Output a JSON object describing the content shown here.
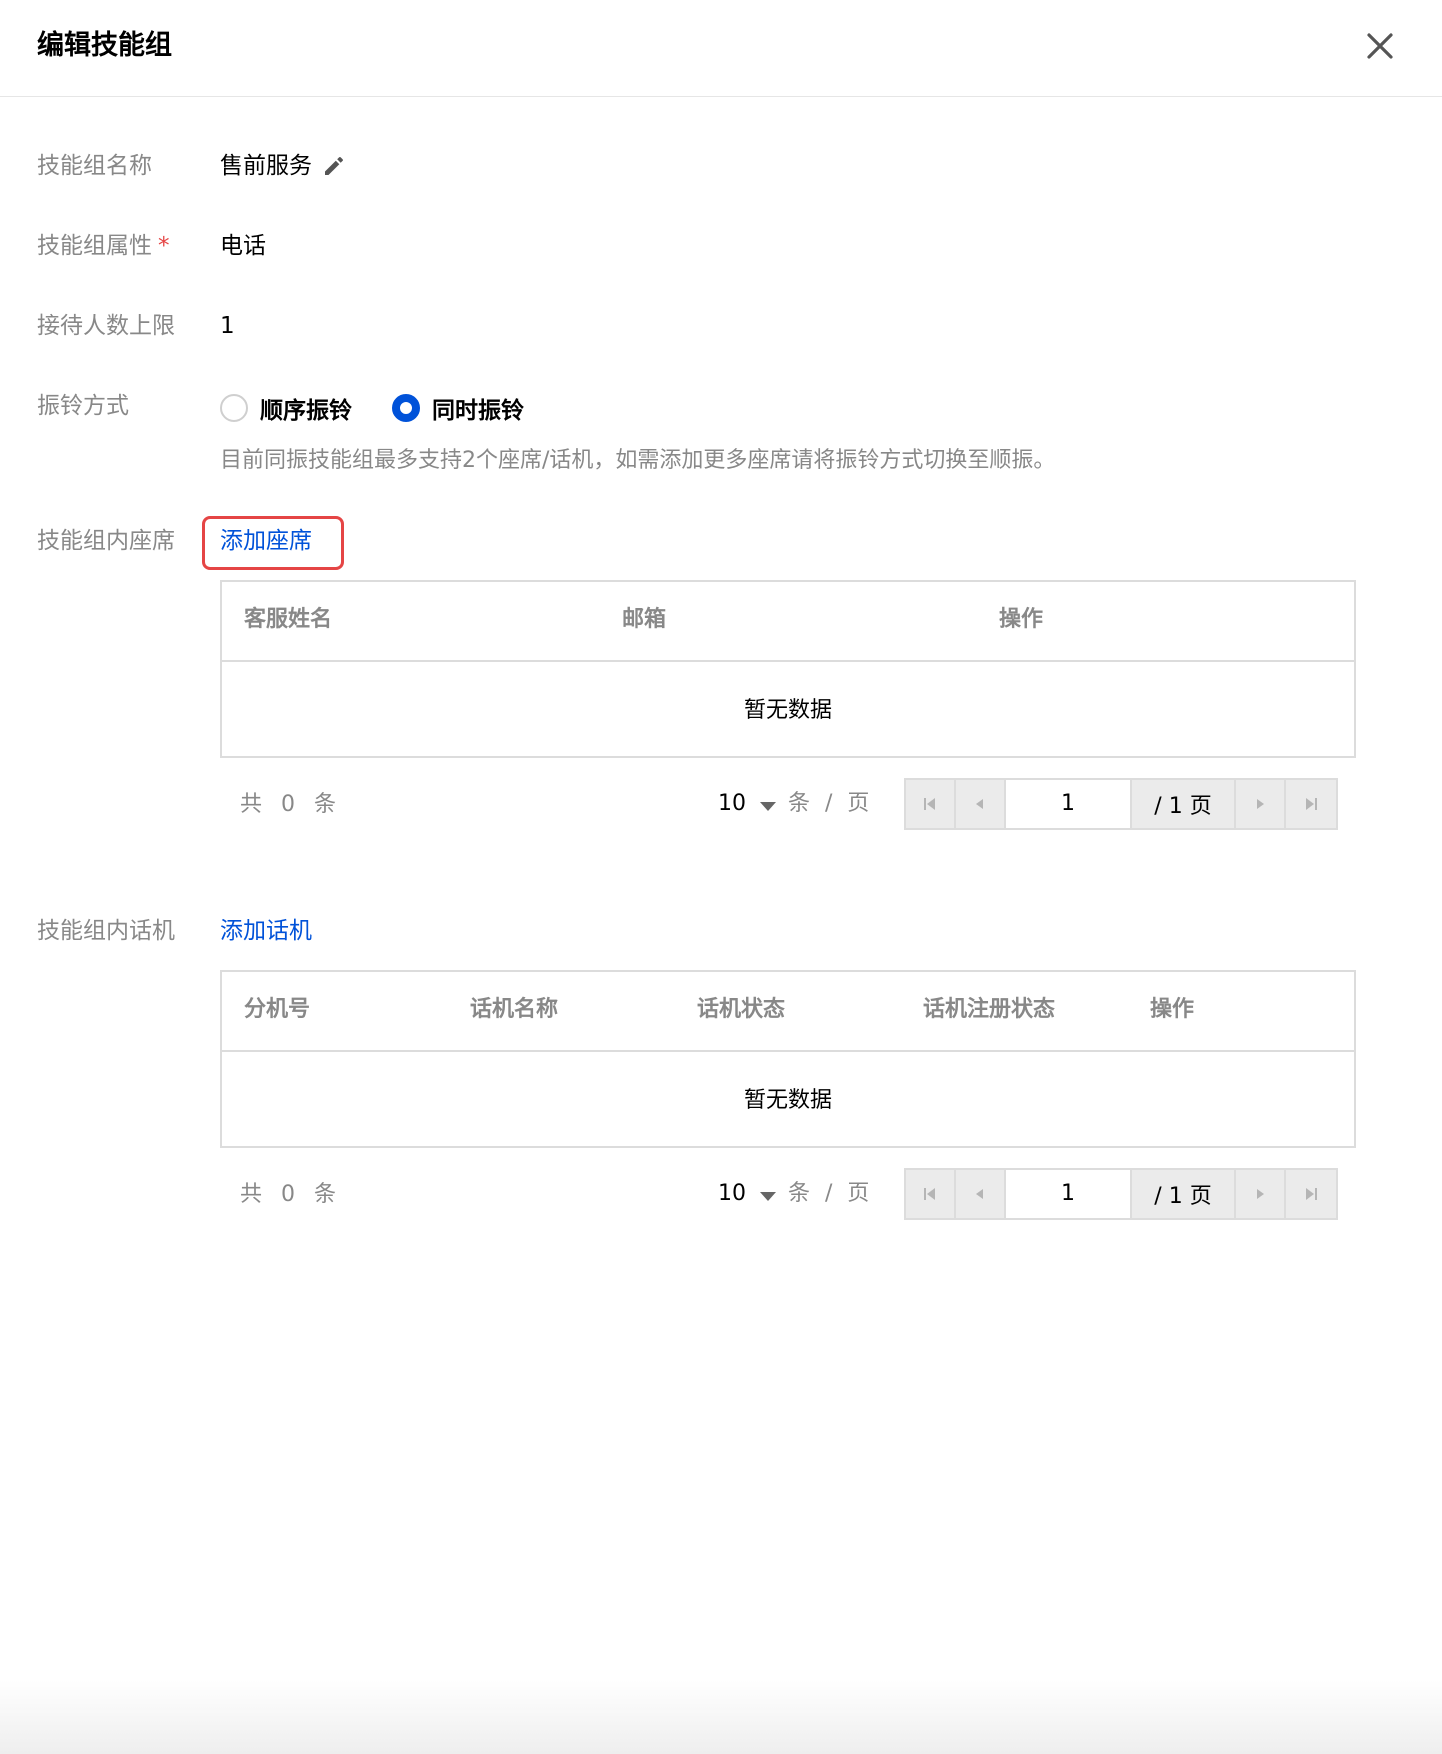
{
  "dialog": {
    "title": "编辑技能组"
  },
  "form": {
    "name_label": "技能组名称",
    "name_value": "售前服务",
    "attr_label": "技能组属性",
    "attr_required": "*",
    "attr_value": "电话",
    "limit_label": "接待人数上限",
    "limit_value": "1",
    "ring_label": "振铃方式",
    "ring_options": [
      {
        "label": "顺序振铃",
        "selected": false
      },
      {
        "label": "同时振铃",
        "selected": true
      }
    ],
    "ring_hint": "目前同振技能组最多支持2个座席/话机，如需添加更多座席请将振铃方式切换至顺振。"
  },
  "agents": {
    "label": "技能组内座席",
    "add_link": "添加座席",
    "columns": [
      "客服姓名",
      "邮箱",
      "操作"
    ],
    "empty_text": "暂无数据",
    "pagination": {
      "total_text": "共 0 条",
      "page_size": "10",
      "per_page_text": "条 / 页",
      "current_page": "1",
      "total_pages_text": "/ 1 页"
    }
  },
  "phones": {
    "label": "技能组内话机",
    "add_link": "添加话机",
    "columns": [
      "分机号",
      "话机名称",
      "话机状态",
      "话机注册状态",
      "操作"
    ],
    "empty_text": "暂无数据",
    "pagination": {
      "total_text": "共 0 条",
      "page_size": "10",
      "per_page_text": "条 / 页",
      "current_page": "1",
      "total_pages_text": "/ 1 页"
    }
  },
  "colors": {
    "accent": "#0052d9",
    "highlight": "#e54545",
    "muted": "#888888"
  },
  "icons": [
    "close-icon",
    "edit-pencil-icon",
    "first-page-icon",
    "prev-page-icon",
    "next-page-icon",
    "last-page-icon",
    "dropdown-caret-icon"
  ]
}
